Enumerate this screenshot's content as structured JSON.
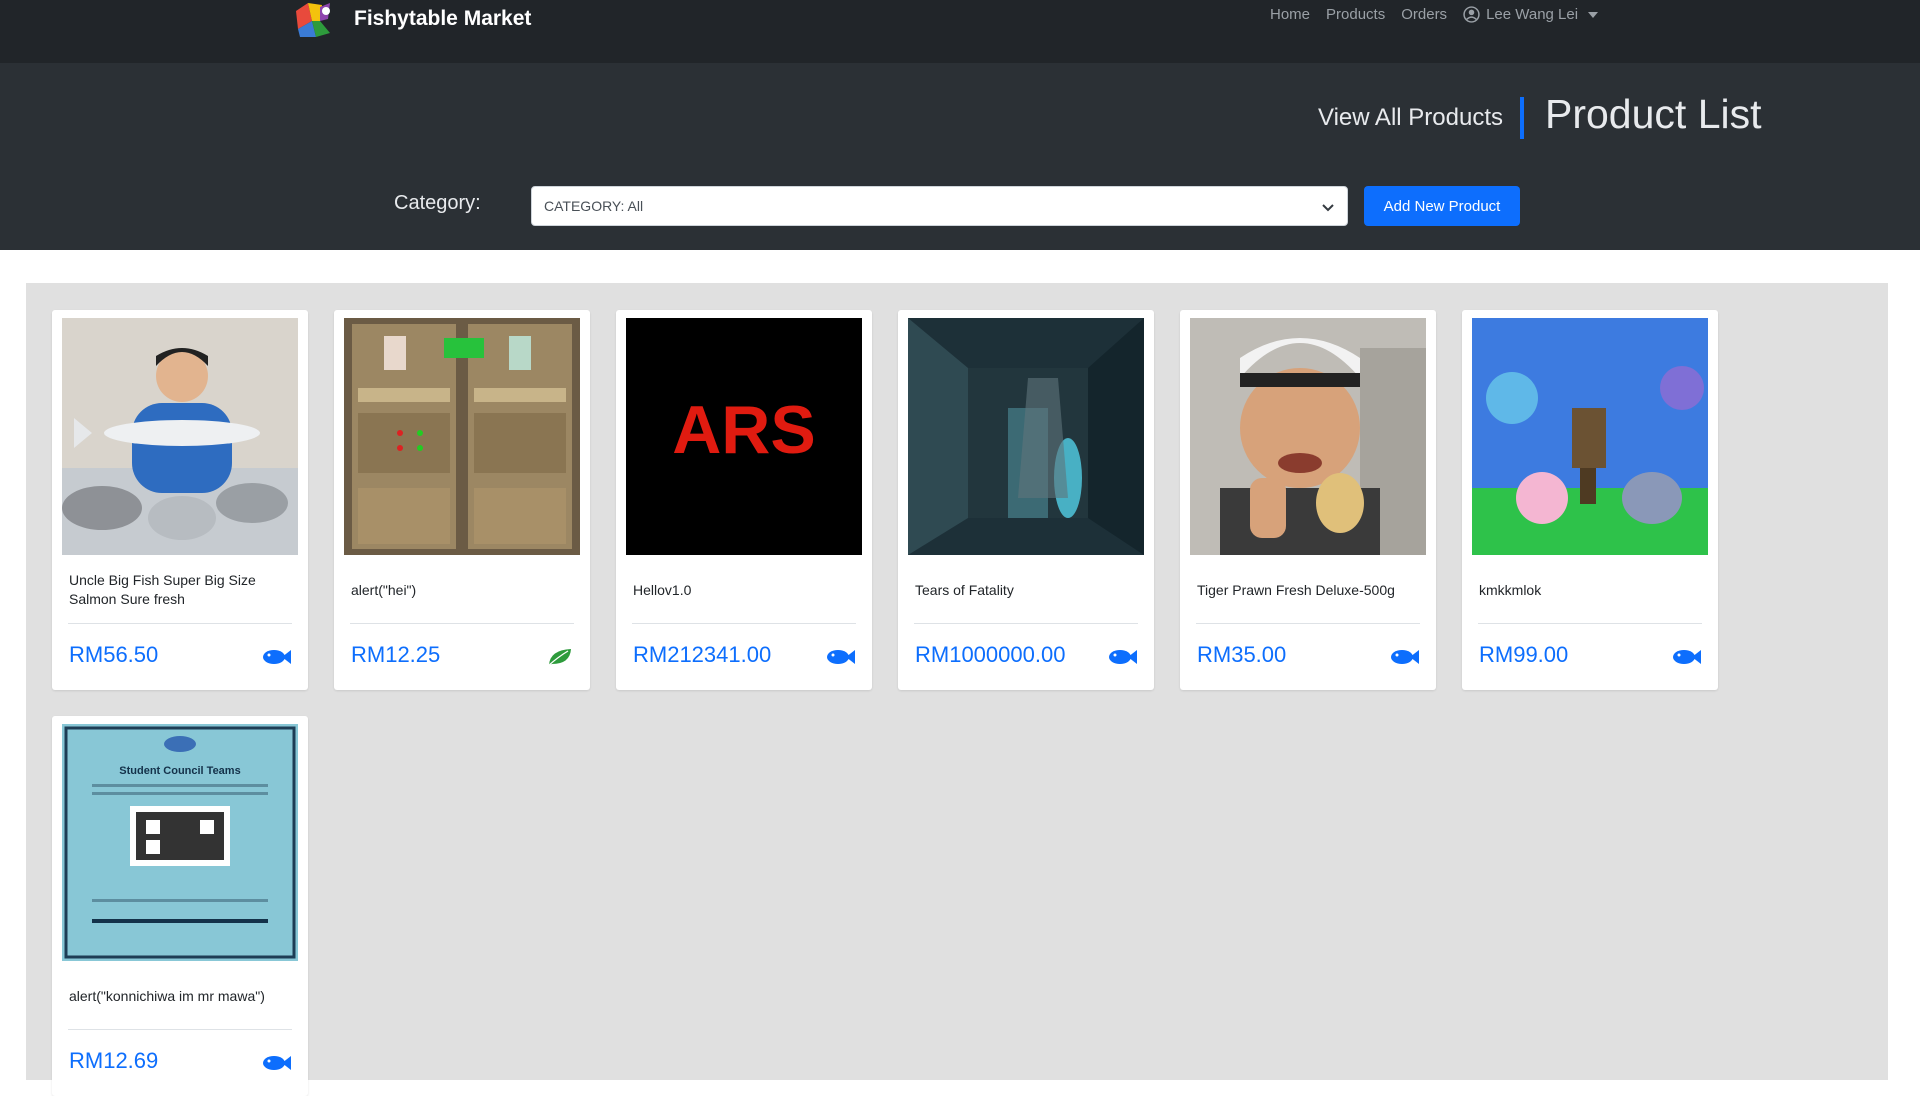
{
  "navbar": {
    "brand_name": "Fishytable Market",
    "links": [
      "Home",
      "Products",
      "Orders"
    ],
    "user_name": "Lee Wang Lei"
  },
  "header": {
    "view_all_label": "View All Products",
    "page_title": "Product List",
    "category_label": "Category:",
    "category_selected": "CATEGORY: All",
    "add_button_label": "Add New Product"
  },
  "colors": {
    "navbar_bg": "#212529",
    "header_bg": "#2b3035",
    "accent": "#0d6efd",
    "leaf_green": "#2e9b3c",
    "panel_bg": "#e0e0e0"
  },
  "products": [
    {
      "name": "Uncle Big Fish Super Big Size Salmon Sure fresh",
      "price": "RM56.50",
      "icon": "fish-icon"
    },
    {
      "name": "alert(\"hei\")",
      "price": "RM12.25",
      "icon": "leaf-icon"
    },
    {
      "name": "Hellov1.0",
      "price": "RM212341.00",
      "icon": "fish-icon",
      "image_text": "ARS"
    },
    {
      "name": "Tears of Fatality",
      "price": "RM1000000.00",
      "icon": "fish-icon"
    },
    {
      "name": "Tiger Prawn Fresh Deluxe-500g",
      "price": "RM35.00",
      "icon": "fish-icon"
    },
    {
      "name": "kmkkmlok",
      "price": "RM99.00",
      "icon": "fish-icon"
    },
    {
      "name": "alert(\"konnichiwa im mr mawa\")",
      "price": "RM12.69",
      "icon": "fish-icon",
      "image_text": "Student Council Teams"
    }
  ]
}
